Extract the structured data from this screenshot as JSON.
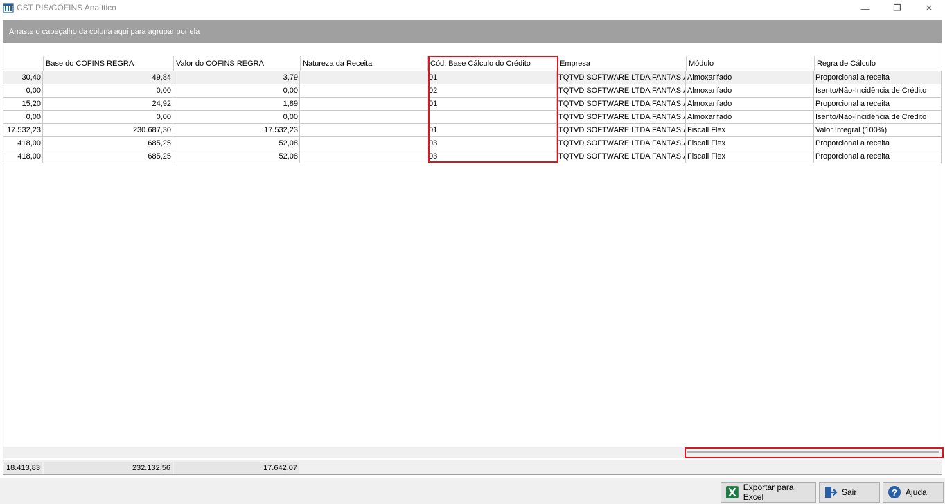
{
  "window": {
    "title": "CST PIS/COFINS Analítico",
    "minimize": "—",
    "restore": "❐",
    "close": "✕"
  },
  "group_panel": {
    "text": "Arraste o cabeçalho da coluna aqui para agrupar por ela"
  },
  "grid": {
    "columns": [
      "",
      "Base do COFINS REGRA",
      "Valor do COFINS REGRA",
      "Natureza da Receita",
      "Cód. Base Cálculo do Crédito",
      "Empresa",
      "Módulo",
      "Regra de Cálculo"
    ],
    "rows": [
      [
        "30,40",
        "49,84",
        "3,79",
        "",
        "01",
        "TQTVD SOFTWARE LTDA FANTASIA",
        "Almoxarifado",
        "Proporcional a receita"
      ],
      [
        "0,00",
        "0,00",
        "0,00",
        "",
        "02",
        "TQTVD SOFTWARE LTDA FANTASIA",
        "Almoxarifado",
        "Isento/Não-Incidência de Crédito"
      ],
      [
        "15,20",
        "24,92",
        "1,89",
        "",
        "01",
        "TQTVD SOFTWARE LTDA FANTASIA",
        "Almoxarifado",
        "Proporcional a receita"
      ],
      [
        "0,00",
        "0,00",
        "0,00",
        "",
        "",
        "TQTVD SOFTWARE LTDA FANTASIA",
        "Almoxarifado",
        "Isento/Não-Incidência de Crédito"
      ],
      [
        "17.532,23",
        "230.687,30",
        "17.532,23",
        "",
        "01",
        "TQTVD SOFTWARE LTDA FANTASIA",
        "Fiscall Flex",
        "Valor Integral (100%)"
      ],
      [
        "418,00",
        "685,25",
        "52,08",
        "",
        "03",
        "TQTVD SOFTWARE LTDA FANTASIA",
        "Fiscall Flex",
        "Proporcional a receita"
      ],
      [
        "418,00",
        "685,25",
        "52,08",
        "",
        "03",
        "TQTVD SOFTWARE LTDA FANTASIA",
        "Fiscall Flex",
        "Proporcional a receita"
      ]
    ],
    "footer_totals": [
      "18.413,83",
      "232.132,56",
      "17.642,07"
    ]
  },
  "buttons": {
    "export_excel": "Exportar para Excel",
    "sair": "Sair",
    "ajuda": "Ajuda"
  },
  "colors": {
    "highlight": "#e0141e",
    "group_panel": "#a0a0a0"
  }
}
